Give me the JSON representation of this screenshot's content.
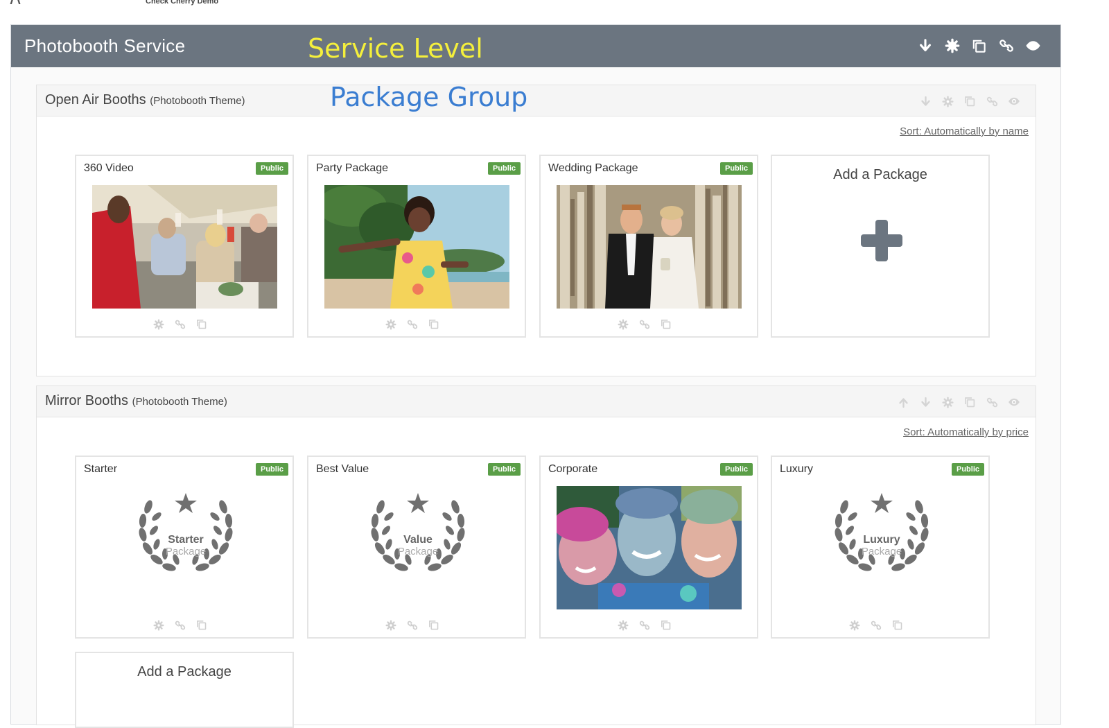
{
  "topbar": {
    "company": "Check Cherry Demo"
  },
  "service": {
    "title": "Photobooth Service",
    "annotation": "Service Level",
    "tools": [
      "arrow-down-icon",
      "gear-icon",
      "copy-icon",
      "link-icon",
      "eye-icon"
    ]
  },
  "groups": [
    {
      "title": "Open Air Booths",
      "theme": "(Photobooth Theme)",
      "annotation": "Package Group",
      "sort": "Sort: Automatically by name",
      "packages": [
        {
          "name": "360 Video",
          "badge": "Public"
        },
        {
          "name": "Party Package",
          "badge": "Public"
        },
        {
          "name": "Wedding Package",
          "badge": "Public"
        }
      ],
      "add_label": "Add a Package"
    },
    {
      "title": "Mirror Booths",
      "theme": "(Photobooth Theme)",
      "sort": "Sort: Automatically by price",
      "packages": [
        {
          "name": "Starter",
          "badge": "Public",
          "wreath_top": "Starter",
          "wreath_bottom": "Package"
        },
        {
          "name": "Best Value",
          "badge": "Public",
          "wreath_top": "Value",
          "wreath_bottom": "Package"
        },
        {
          "name": "Corporate",
          "badge": "Public"
        },
        {
          "name": "Luxury",
          "badge": "Public",
          "wreath_top": "Luxury",
          "wreath_bottom": "Package"
        }
      ],
      "add_label": "Add a Package"
    }
  ],
  "colors": {
    "service_header": "#6b7580",
    "badge_public": "#5a9e47",
    "annotation_service": "#f4ef3c",
    "annotation_group": "#3a7dd1"
  }
}
